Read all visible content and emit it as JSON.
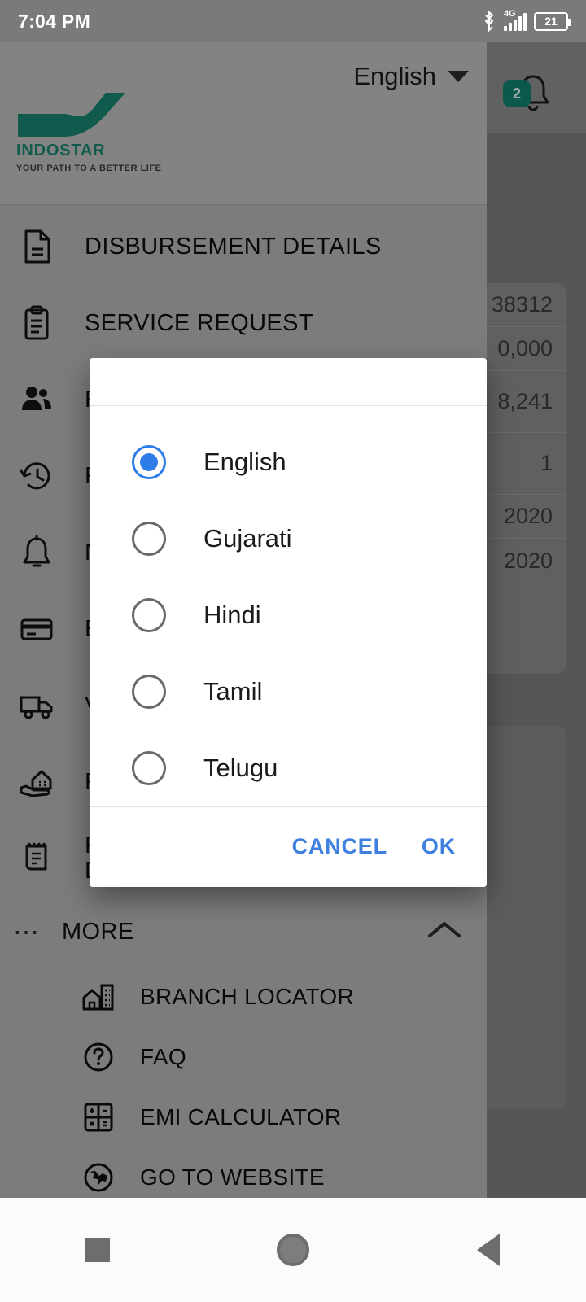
{
  "status_bar": {
    "time": "7:04 PM",
    "battery_level": "21",
    "network": "4G",
    "icons": [
      "bluetooth-icon",
      "signal-icon",
      "battery-icon"
    ]
  },
  "header": {
    "language_selected": "English",
    "brand_name": "INDOSTAR",
    "brand_tagline": "YOUR PATH TO A BETTER LIFE",
    "brand_color": "#17836f",
    "notification_count": "2"
  },
  "drawer": {
    "items": [
      {
        "label": "DISBURSEMENT DETAILS",
        "icon": "document-icon"
      },
      {
        "label": "SERVICE REQUEST",
        "icon": "clipboard-icon"
      },
      {
        "label": "R",
        "icon": "people-icon"
      },
      {
        "label": "R",
        "icon": "history-icon"
      },
      {
        "label": "N",
        "icon": "bell-icon"
      },
      {
        "label": "E",
        "icon": "credit-card-icon"
      },
      {
        "label": "V",
        "icon": "truck-icon"
      },
      {
        "label": "R",
        "icon": "hand-house-icon"
      },
      {
        "label": "R\nD",
        "icon": "receipt-icon"
      }
    ],
    "more": {
      "label": "MORE",
      "icon": "ellipsis-icon",
      "chevron": "chevron-up-icon"
    },
    "more_items": [
      {
        "label": "BRANCH LOCATOR",
        "icon": "branch-building-icon"
      },
      {
        "label": "FAQ",
        "icon": "question-circle-icon"
      },
      {
        "label": "EMI CALCULATOR",
        "icon": "calculator-icon"
      },
      {
        "label": "GO TO WEBSITE",
        "icon": "globe-icon"
      }
    ]
  },
  "background_card": {
    "values": [
      "38312",
      "0,000",
      "8,241",
      "1",
      "2020",
      "2020"
    ]
  },
  "dialog": {
    "title": "",
    "options": [
      {
        "label": "English",
        "selected": true
      },
      {
        "label": "Gujarati",
        "selected": false
      },
      {
        "label": "Hindi",
        "selected": false
      },
      {
        "label": "Tamil",
        "selected": false
      },
      {
        "label": "Telugu",
        "selected": false
      }
    ],
    "cancel_label": "CANCEL",
    "ok_label": "OK",
    "accent_color": "#3f7fe0"
  },
  "nav_bar": {
    "recents_label": "recents",
    "home_label": "home",
    "back_label": "back"
  }
}
